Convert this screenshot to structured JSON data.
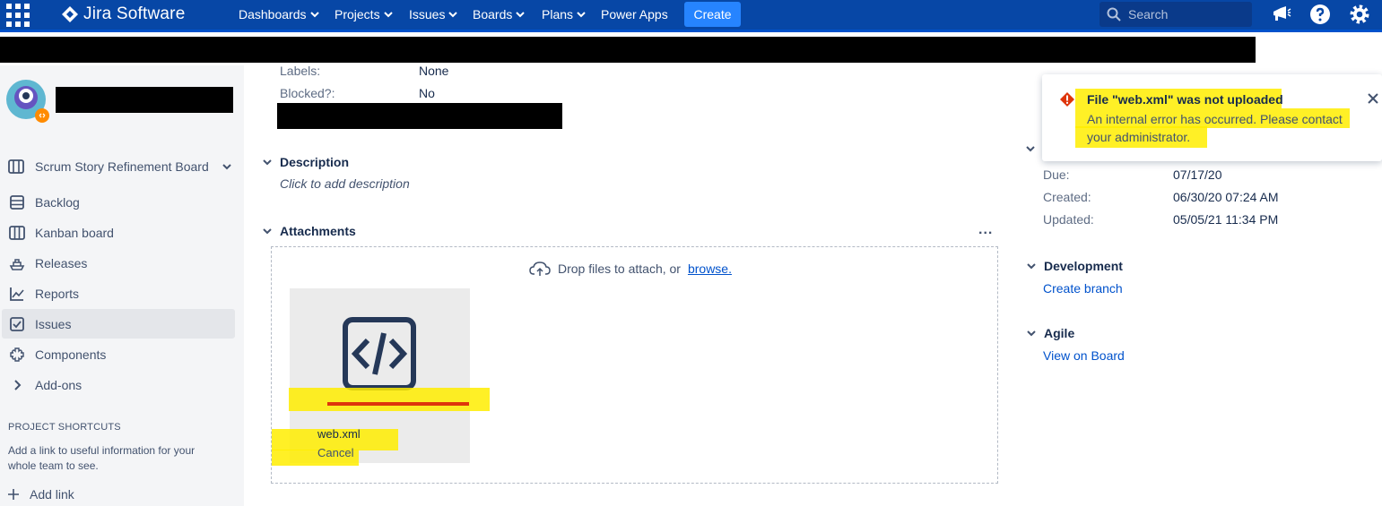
{
  "topnav": {
    "app_name": "Jira Software",
    "items": [
      {
        "label": "Dashboards"
      },
      {
        "label": "Projects"
      },
      {
        "label": "Issues"
      },
      {
        "label": "Boards"
      },
      {
        "label": "Plans"
      },
      {
        "label": "Power Apps"
      }
    ],
    "create_label": "Create",
    "search_placeholder": "Search",
    "colors": {
      "nav_bg": "#0747a6",
      "create_bg": "#2684ff"
    }
  },
  "sidebar": {
    "board_selector": "Scrum Story Refinement Board",
    "items": [
      {
        "label": "Backlog",
        "icon": "backlog-icon"
      },
      {
        "label": "Kanban board",
        "icon": "kanban-board-icon"
      },
      {
        "label": "Releases",
        "icon": "releases-icon"
      },
      {
        "label": "Reports",
        "icon": "reports-icon"
      },
      {
        "label": "Issues",
        "icon": "issues-icon",
        "active": true
      },
      {
        "label": "Components",
        "icon": "components-icon"
      },
      {
        "label": "Add-ons",
        "icon": "chevron-right-icon"
      }
    ],
    "shortcuts_heading": "PROJECT SHORTCUTS",
    "shortcuts_desc": "Add a link to useful information for your whole team to see.",
    "add_link": "Add link"
  },
  "details": {
    "fields": [
      {
        "label": "Labels:",
        "value": "None"
      },
      {
        "label": "Blocked?:",
        "value": "No"
      }
    ]
  },
  "description": {
    "heading": "Description",
    "placeholder": "Click to add description"
  },
  "attachments": {
    "heading": "Attachments",
    "more": "...",
    "drop_text": "Drop files to attach, or",
    "browse_link": "browse.",
    "file": {
      "name": "web.xml",
      "cancel": "Cancel",
      "icon": "code-file-icon"
    }
  },
  "dates": [
    {
      "label": "Due:",
      "value": "07/17/20"
    },
    {
      "label": "Created:",
      "value": "06/30/20 07:24 AM"
    },
    {
      "label": "Updated:",
      "value": "05/05/21 11:34 PM"
    }
  ],
  "development": {
    "heading": "Development",
    "link": "Create branch"
  },
  "agile": {
    "heading": "Agile",
    "link": "View on Board"
  },
  "flag": {
    "title": "File \"web.xml\" was not uploaded",
    "body": "An internal error has occurred. Please contact your administrator.",
    "color_error": "#de350b",
    "color_highlight": "#ffed00"
  }
}
